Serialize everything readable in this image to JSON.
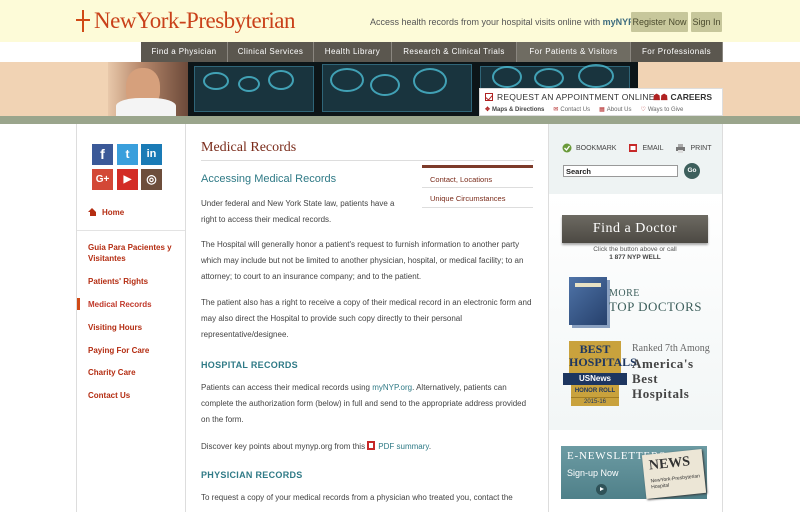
{
  "header": {
    "logo_text": "NewYork-Presbyterian",
    "tagline_prefix": "Access health records from your hospital visits online with",
    "tagline_link": "myNYP.org",
    "register_label": "Register Now",
    "signin_label": "Sign In"
  },
  "nav": [
    "Find a Physician",
    "Clinical Services",
    "Health Library",
    "Research & Clinical Trials",
    "For Patients & Visitors",
    "For Professionals"
  ],
  "banner": {
    "appointment_label": "REQUEST AN APPOINTMENT ONLINE",
    "careers_label": "CAREERS",
    "links": [
      "Maps & Directions",
      "Contact Us",
      "About Us",
      "Ways to Give"
    ]
  },
  "social": {
    "facebook": "f",
    "twitter": "t",
    "linkedin": "in",
    "googleplus": "G+",
    "youtube": "▶",
    "instagram": "◎"
  },
  "leftnav": {
    "home_label": "Home",
    "items": [
      "Guia Para Pacientes y Visitantes",
      "Patients' Rights",
      "Medical Records",
      "Visiting Hours",
      "Paying For Care",
      "Charity Care",
      "Contact Us"
    ]
  },
  "main": {
    "title": "Medical Records",
    "subtitle": "Accessing Medical Records",
    "sidebox": [
      "Contact, Locations",
      "Unique Circumstances"
    ],
    "p1": "Under federal and New York State law, patients have a right to access their medical records.",
    "p2": "The Hospital will generally honor a patient's request to furnish information to another party which may include but not be limited to another physician, hospital, or medical facility; to an attorney; to court to an insurance company; and to the patient.",
    "p3": "The patient also has a right to receive a copy of their medical record in an electronic form and may also direct the Hospital to provide such copy directly to their personal representative/designee.",
    "hospital_heading": "HOSPITAL RECORDS",
    "p4_pre": "Patients can access their medical records using ",
    "p4_link": "myNYP.org",
    "p4_post": ". Alternatively, patients can complete the authorization form (below) in full and send to the appropriate address provided on the form.",
    "p5_pre": "Discover key points about mynyp.org from this ",
    "p5_link": "PDF summary",
    "p5_post": ".",
    "physician_heading": "PHYSICIAN RECORDS",
    "p6": "To request a copy of your medical records from a physician who treated you, contact the"
  },
  "rightcol": {
    "bookmark": "BOOKMARK",
    "email": "EMAIL",
    "print": "PRINT",
    "search_value": "Search",
    "go_label": "Go",
    "find_doctor": "Find a Doctor",
    "find_sub1": "Click the button above or call",
    "find_sub2": "1 877 NYP WELL",
    "more_a": "MORE",
    "more_b": "TOP DOCTORS",
    "badge_best": "BEST HOSPITALS",
    "badge_usnews": "USNews",
    "badge_honor": "HONOR ROLL",
    "badge_year": "2015-16",
    "ranked_line1": "Ranked 7th Among",
    "ranked_line2": "America's",
    "ranked_line3": "Best",
    "ranked_line4": "Hospitals",
    "enews_title": "E-NEWSLETTERS",
    "enews_signup": "Sign-up Now",
    "enews_paper": "NEWS",
    "enews_paper_sub": "NewYork-Presbyterian Hospital"
  },
  "colors": {
    "brand": "#c9411a",
    "nav_bg": "#5b574f",
    "link_teal": "#2f7a86",
    "accent_red": "#b42d12"
  }
}
